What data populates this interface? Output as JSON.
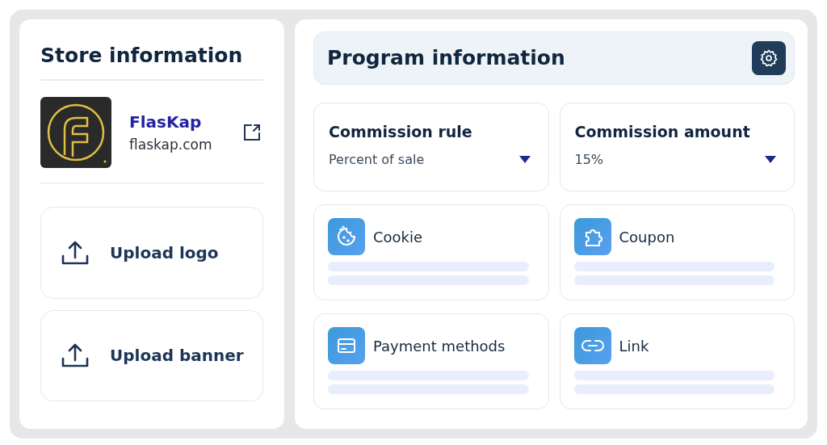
{
  "store": {
    "title": "Store information",
    "name": "FlasKap",
    "domain": "flaskap.com",
    "uploads": [
      {
        "label": "Upload logo"
      },
      {
        "label": "Upload banner"
      }
    ]
  },
  "program": {
    "title": "Program information",
    "selects": [
      {
        "label": "Commission rule",
        "value": "Percent of sale"
      },
      {
        "label": "Commission amount",
        "value": "15%"
      }
    ],
    "features": [
      {
        "kind": "cookie",
        "label": "Cookie"
      },
      {
        "kind": "coupon",
        "label": "Coupon"
      },
      {
        "kind": "payment",
        "label": "Payment methods"
      },
      {
        "kind": "link",
        "label": "Link"
      }
    ]
  }
}
